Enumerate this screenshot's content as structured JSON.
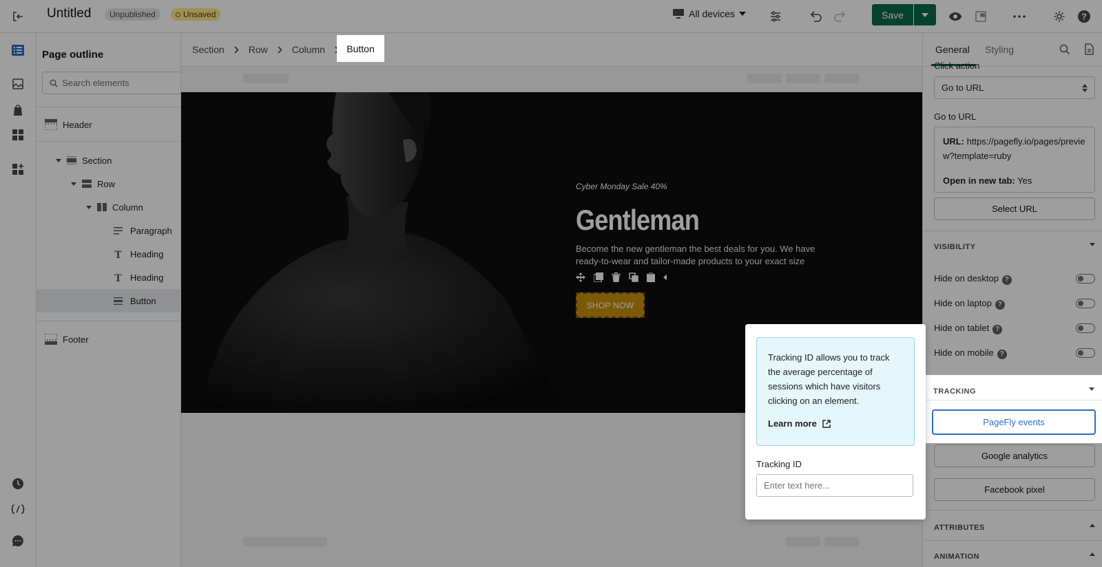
{
  "header": {
    "title": "Untitled",
    "badge_unpublished": "Unpublished",
    "badge_unsaved": "Unsaved",
    "device_label": "All devices",
    "save_label": "Save"
  },
  "outline": {
    "title": "Page outline",
    "search_placeholder": "Search elements",
    "items": [
      {
        "label": "Header"
      },
      {
        "label": "Section"
      },
      {
        "label": "Row"
      },
      {
        "label": "Column"
      },
      {
        "label": "Paragraph"
      },
      {
        "label": "Heading"
      },
      {
        "label": "Heading"
      },
      {
        "label": "Button"
      },
      {
        "label": "Footer"
      }
    ]
  },
  "breadcrumb": [
    "Section",
    "Row",
    "Column",
    "Button"
  ],
  "hero": {
    "eyebrow": "Cyber Monday Sale 40%",
    "heading": "Gentleman",
    "body": "Become the new gentleman the best deals for you. We have ready-to-wear and tailor-made products to your exact size",
    "button": "SHOP NOW"
  },
  "panel": {
    "tab_general": "General",
    "tab_styling": "Styling",
    "click_action_label": "Click action",
    "click_action_value": "Go to URL",
    "go_to_url_label": "Go to URL",
    "url_label": "URL:",
    "url_value": "https://pagefly.io/pages/preview?template=ruby",
    "new_tab_label": "Open in new tab:",
    "new_tab_value": "Yes",
    "select_url": "Select URL",
    "visibility_title": "VISIBILITY",
    "visibility": [
      {
        "label": "Hide on desktop"
      },
      {
        "label": "Hide on laptop"
      },
      {
        "label": "Hide on tablet"
      },
      {
        "label": "Hide on mobile"
      }
    ],
    "tracking_title": "TRACKING",
    "pagefly_events": "PageFly events",
    "google_analytics": "Google analytics",
    "facebook_pixel": "Facebook pixel",
    "attributes_title": "ATTRIBUTES",
    "animation_title": "ANIMATION"
  },
  "popover": {
    "info_text": "Tracking ID allows you to track the average percentage of sessions which have visitors clicking on an element.",
    "learn_more": "Learn more",
    "field_label": "Tracking ID",
    "field_placeholder": "Enter text here..."
  },
  "colors": {
    "accent_green": "#0b6b4b",
    "button_gold": "#c8900f",
    "link_blue": "#2c6ecb"
  }
}
